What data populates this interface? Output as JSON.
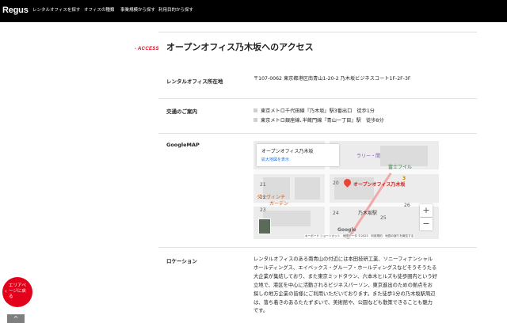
{
  "header": {
    "logo": "Regus",
    "nav": [
      "レンタルオフィスを探す",
      "オフィスの種類",
      "事業規模から探す",
      "利用目的から探す"
    ]
  },
  "access": {
    "tag": "ACCESS",
    "title": "オープンオフィス乃木坂へのアクセス"
  },
  "address": {
    "label": "レンタルオフィス所在地",
    "text": "〒107-0062 東京都港区南青山1-20-2 乃木坂ビジネスコート1F-2F-3F"
  },
  "transit": {
    "label": "交通のご案内",
    "lines": [
      "東京メトロ千代田線『乃木坂』駅3番出口　徒歩1分",
      "東京メトロ銀座線､半蔵門線『青山一丁目』駅　徒歩8分"
    ]
  },
  "map": {
    "label": "GoogleMAP",
    "card_title": "オープンオフィス乃木坂",
    "card_link": "拡大地図を表示",
    "pin_label": "オープンオフィス乃木坂",
    "station_label": "乃木坂駅",
    "hotel_label": "ダ・ヴィンチ",
    "gallery_label": "ラリー・間",
    "fuji_label": "富士フイル",
    "park_label": "ガーデン",
    "numbers": [
      "21",
      "20",
      "22",
      "23",
      "24",
      "25",
      "26",
      "3"
    ],
    "zoom_in": "+",
    "zoom_out": "−",
    "google": "Google",
    "footer": "キーボード ショートカット　地図データ ©2023　利用規約　地図の誤りを報告する",
    "watermark": "©2023"
  },
  "location": {
    "label": "ロケーション",
    "text": "レンタルオフィスのある南青山の付近には本田技研工業、ソニーフィナンシャルホールディングス、エイベックス・グループ・ホールディングスなどそうそうたる大企業が集結しており、また東京ミッドタウン、六本木ヒルズも徒歩圏内という好立地で、港区を中心に活動されるビジネスパーソン、東京進出のための拠点をお探しの地方企業の皆様にご利用いただいております。また徒歩1分の乃木坂駅周辺は、落ち着きのあるたたずまいで、美術館や、公園なども散策できることも魅力です。"
  },
  "floating": {
    "back_label": "エリアページに戻る",
    "back_arrow": "‹",
    "to_top": "^"
  },
  "colors": {
    "brand_red": "#e3001b",
    "nav_bg": "#000000"
  }
}
